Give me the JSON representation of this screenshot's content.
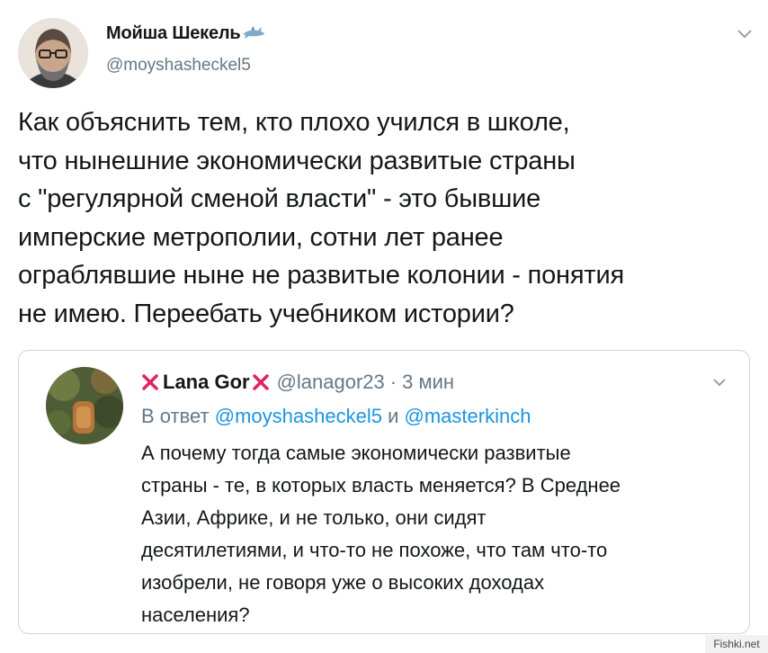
{
  "tweet": {
    "author_name": "Мойша Шекель",
    "author_handle": "@moyshasheckel5",
    "name_emoji_icon": "shark-icon",
    "text": "Как объяснить тем, кто плохо учился в школе,\nчто нынешние экономически развитые страны\nс \"регулярной сменой власти\" - это бывшие\nимперские метрополии, сотни лет ранее\nограблявшие ныне не развитые колонии - понятия\nне имею. Переебать учебником истории?"
  },
  "quote": {
    "author_name": "Lana Gor",
    "author_handle": "@lanagor23",
    "separator": "·",
    "time": "3 мин",
    "reply_prefix": "В ответ",
    "reply_user_1": "@moyshasheckel5",
    "reply_joiner": "и",
    "reply_user_2": "@masterkinch",
    "text": "А почему тогда самые экономически развитые\nстраны - те, в которых власть меняется? В Среднее\nАзии, Африке, и не только, они сидят\nдесятилетиями, и что-то не похоже, что там что-то\nизобрели, не говоря уже о высоких доходах\nнаселения?"
  },
  "watermark": "Fishki.net",
  "colors": {
    "text": "#14171a",
    "secondary": "#657786",
    "link": "#1b95e0",
    "border": "#ccd6dd",
    "cross": "#e0245e"
  }
}
